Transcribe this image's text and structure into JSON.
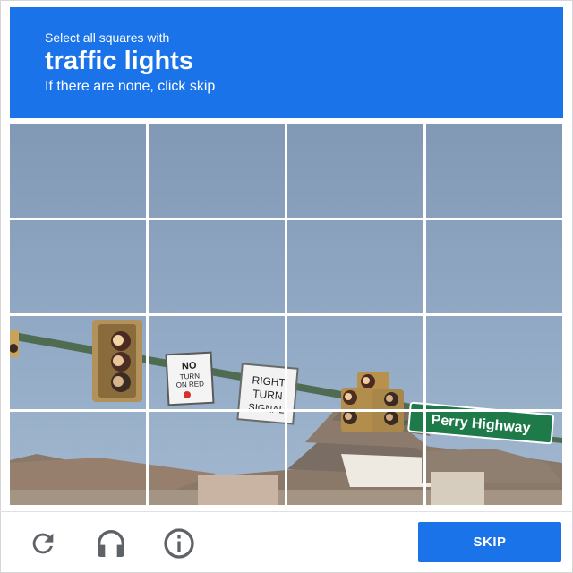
{
  "challenge": {
    "instruction": "Select all squares with",
    "keyword": "traffic lights",
    "hint": "If there are none, click skip"
  },
  "grid": {
    "rows": 4,
    "cols": 4
  },
  "scene": {
    "no_turn_sign": [
      "NO",
      "TURN",
      "ON RED"
    ],
    "right_turn_sign": [
      "RIGHT",
      "TURN",
      "SIGNAL"
    ],
    "street_sign": "Perry Highway"
  },
  "footer": {
    "icons": [
      "reload-icon",
      "audio-icon",
      "info-icon"
    ],
    "skip_label": "SKIP"
  },
  "colors": {
    "brand_blue": "#1a73e8",
    "sky": "#8ba5c1",
    "icon_gray": "#5f6368"
  }
}
